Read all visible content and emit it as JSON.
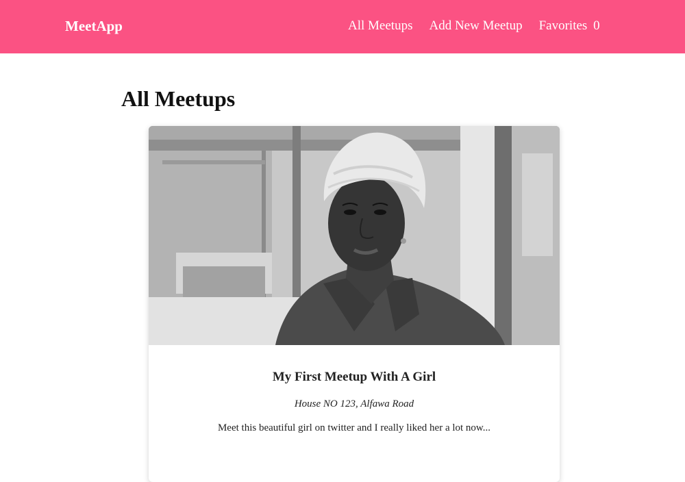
{
  "header": {
    "brand": "MeetApp",
    "nav": {
      "all_meetups": "All Meetups",
      "add_new_meetup": "Add New Meetup",
      "favorites_label": "Favorites",
      "favorites_count": "0"
    },
    "colors": {
      "header_bg": "#fb5283",
      "header_text": "#ffffff"
    }
  },
  "main": {
    "page_title": "All Meetups",
    "meetups": [
      {
        "title": "My First Meetup With A Girl",
        "address": "House NO 123, Alfawa Road",
        "description": "Meet this beautiful girl on twitter and I really liked her a lot now..."
      }
    ]
  }
}
